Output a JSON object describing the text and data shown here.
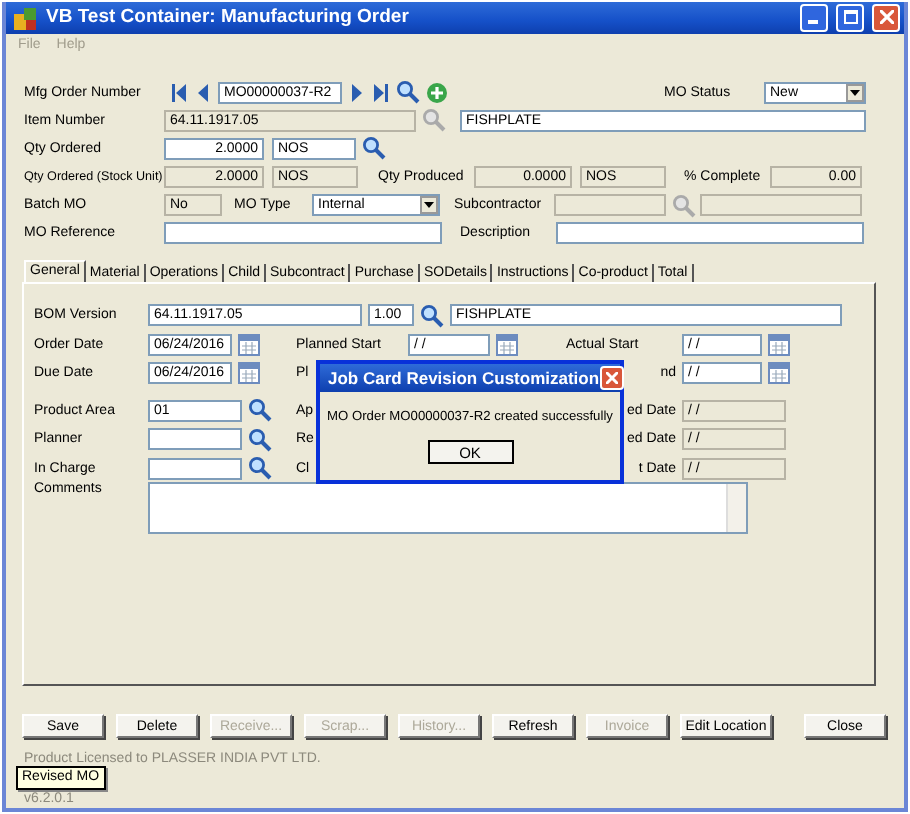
{
  "window": {
    "title": "VB Test Container: Manufacturing Order"
  },
  "menu": [
    {
      "label": "File",
      "disabled": true
    },
    {
      "label": "Help",
      "disabled": true
    }
  ],
  "header": {
    "mfg_order_number": {
      "label": "Mfg Order Number",
      "value": "MO00000037-R2"
    },
    "mo_status": {
      "label": "MO Status",
      "value": "New"
    },
    "item_number": {
      "label": "Item Number",
      "value": "64.11.1917.05",
      "description": "FISHPLATE"
    },
    "qty_ordered": {
      "label": "Qty Ordered",
      "value": "2.0000",
      "unit": "NOS"
    },
    "qty_ordered_stock": {
      "label": "Qty Ordered (Stock Unit)",
      "value": "2.0000",
      "unit": "NOS"
    },
    "qty_produced": {
      "label": "Qty Produced",
      "value": "0.0000",
      "unit": "NOS"
    },
    "percent_complete": {
      "label": "% Complete",
      "value": "0.00"
    },
    "batch_mo": {
      "label": "Batch MO",
      "value": "No"
    },
    "mo_type": {
      "label": "MO Type",
      "value": "Internal"
    },
    "subcontractor": {
      "label": "Subcontractor"
    },
    "mo_reference": {
      "label": "MO Reference"
    },
    "description": {
      "label": "Description"
    }
  },
  "tabs": [
    {
      "label": "General",
      "selected": true
    },
    {
      "label": "Material",
      "selected": false
    },
    {
      "label": "Operations",
      "selected": false
    },
    {
      "label": "Child",
      "selected": false
    },
    {
      "label": "Subcontract",
      "selected": false
    },
    {
      "label": "Purchase",
      "selected": false
    },
    {
      "label": "SODetails",
      "selected": false
    },
    {
      "label": "Instructions",
      "selected": false
    },
    {
      "label": "Co-product",
      "selected": false
    },
    {
      "label": "Total",
      "selected": false
    }
  ],
  "general": {
    "bom_version": {
      "label": "BOM Version",
      "value": "64.11.1917.05",
      "revision": "1.00",
      "description": "FISHPLATE"
    },
    "left": [
      {
        "label": "Order Date",
        "value": "06/24/2016",
        "kind": "date"
      },
      {
        "label": "Due Date",
        "value": "06/24/2016",
        "kind": "date"
      },
      {
        "label": "Product Area",
        "value": "01",
        "kind": "lookup"
      },
      {
        "label": "Planner",
        "kind": "lookup"
      },
      {
        "label": "In Charge",
        "kind": "lookup"
      }
    ],
    "middle": [
      {
        "label": "Planned Start",
        "value": "/ /",
        "kind": "date"
      },
      {
        "label": "Pl"
      },
      {
        "label": "Ap"
      },
      {
        "label": "Re"
      },
      {
        "label": "Cl"
      }
    ],
    "right": [
      {
        "label": "Actual Start",
        "value": "/ /",
        "kind": "date"
      },
      {
        "label": "nd",
        "value": "/ /",
        "kind": "date"
      },
      {
        "label": "ed Date",
        "value": "/ /",
        "kind": "readonly"
      },
      {
        "label": "ed Date",
        "value": "/ /",
        "kind": "readonly"
      },
      {
        "label": "t Date",
        "value": "/ /",
        "kind": "readonly"
      }
    ],
    "comments": {
      "label": "Comments"
    }
  },
  "dialog": {
    "title": "Job Card Revision Customization",
    "message": "MO Order MO00000037-R2 created successfully",
    "button": "OK"
  },
  "buttons": [
    {
      "label": "Save",
      "disabled": false
    },
    {
      "label": "Delete",
      "disabled": false
    },
    {
      "label": "Receive...",
      "disabled": true
    },
    {
      "label": "Scrap...",
      "disabled": true
    },
    {
      "label": "History...",
      "disabled": true
    },
    {
      "label": "Refresh",
      "disabled": false
    },
    {
      "label": "Invoice",
      "disabled": true
    },
    {
      "label": "Edit Location",
      "disabled": false
    },
    {
      "label": "Close",
      "disabled": false
    }
  ],
  "footer": {
    "license": "Product Licensed to PLASSER INDIA PVT LTD.",
    "tooltip": "Revised MO",
    "version": "v6.2.0.1"
  }
}
